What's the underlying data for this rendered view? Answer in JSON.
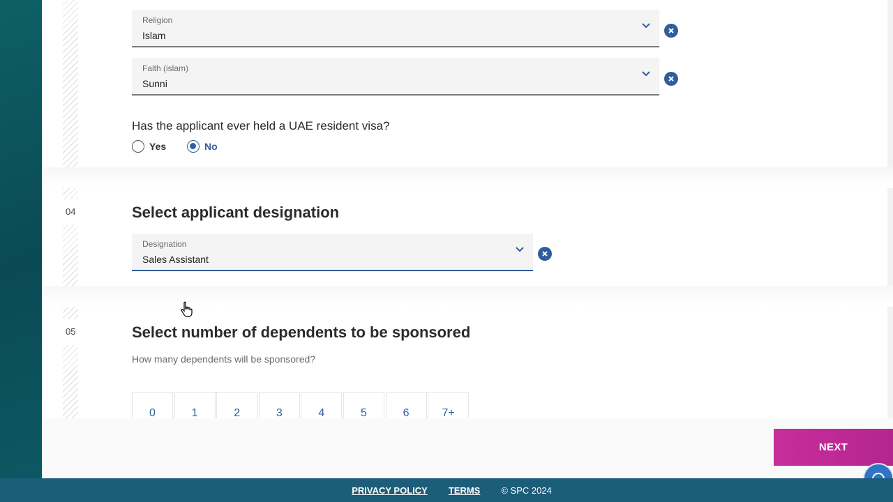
{
  "fields": {
    "religion": {
      "label": "Religion",
      "value": "Islam"
    },
    "faith": {
      "label": "Faith (islam)",
      "value": "Sunni"
    },
    "designation": {
      "label": "Designation",
      "value": "Sales Assistant"
    }
  },
  "visa_question": {
    "text": "Has the applicant ever held a UAE resident visa?",
    "options": [
      "Yes",
      "No"
    ],
    "selected": "No"
  },
  "sections": [
    {
      "number": "04",
      "title": "Select applicant designation"
    },
    {
      "number": "05",
      "title": "Select number of dependents to be sponsored"
    }
  ],
  "dependents": {
    "helper": "How many dependents will be sponsored?",
    "options": [
      "0",
      "1",
      "2",
      "3",
      "4",
      "5",
      "6",
      "7+"
    ]
  },
  "next_label": "NEXT",
  "footer": {
    "privacy": "PRIVACY POLICY",
    "terms": "TERMS",
    "copyright": "© SPC 2024"
  },
  "colors": {
    "accent": "#2f5e9c",
    "next_button": "#c62e9c",
    "footer_bg": "#1c5d79",
    "left_rail": "#0e5f66"
  },
  "icons": [
    "chevron-down-icon",
    "clear-icon",
    "chat-support-icon",
    "pointer-cursor-icon"
  ]
}
